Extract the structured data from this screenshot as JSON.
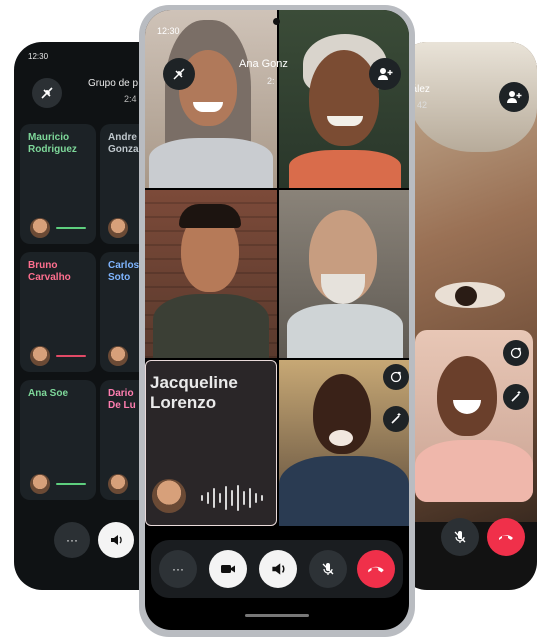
{
  "left_phone": {
    "status_time": "12:30",
    "title": "Grupo de p",
    "duration": "2:4",
    "participants": [
      {
        "name_line1": "Mauricio",
        "name_line2": "Rodriguez",
        "color": "#7ed89a"
      },
      {
        "name_line1": "Andre",
        "name_line2": "Gonza",
        "color": "#bfc7cc"
      },
      {
        "name_line1": "Bruno",
        "name_line2": "Carvalho",
        "color": "#ff6f8f"
      },
      {
        "name_line1": "Carlos",
        "name_line2": "Soto",
        "color": "#7fb5ff"
      },
      {
        "name_line1": "Ana Soe",
        "name_line2": "",
        "color": "#7ed89a"
      },
      {
        "name_line1": "Dario",
        "name_line2": "De Lu",
        "color": "#ff7eb0"
      }
    ],
    "controls": {
      "more": "···",
      "speaker": "🔊"
    }
  },
  "center_phone": {
    "status_time": "12:30",
    "title_fragment": "Ana Gonz",
    "duration_fragment": "2:",
    "speaker_tile": {
      "name": "Jacqueline Lorenzo"
    },
    "controls": {
      "more": "···",
      "video": "video-icon",
      "speaker": "speaker-icon",
      "mic": "mic-off-icon",
      "end": "end-call-icon"
    },
    "colors": {
      "end_call": "#f0304a",
      "speaker_accent": "#e96a8a"
    }
  },
  "right_phone": {
    "title_fragment": "nzález",
    "duration_fragment": "42"
  }
}
